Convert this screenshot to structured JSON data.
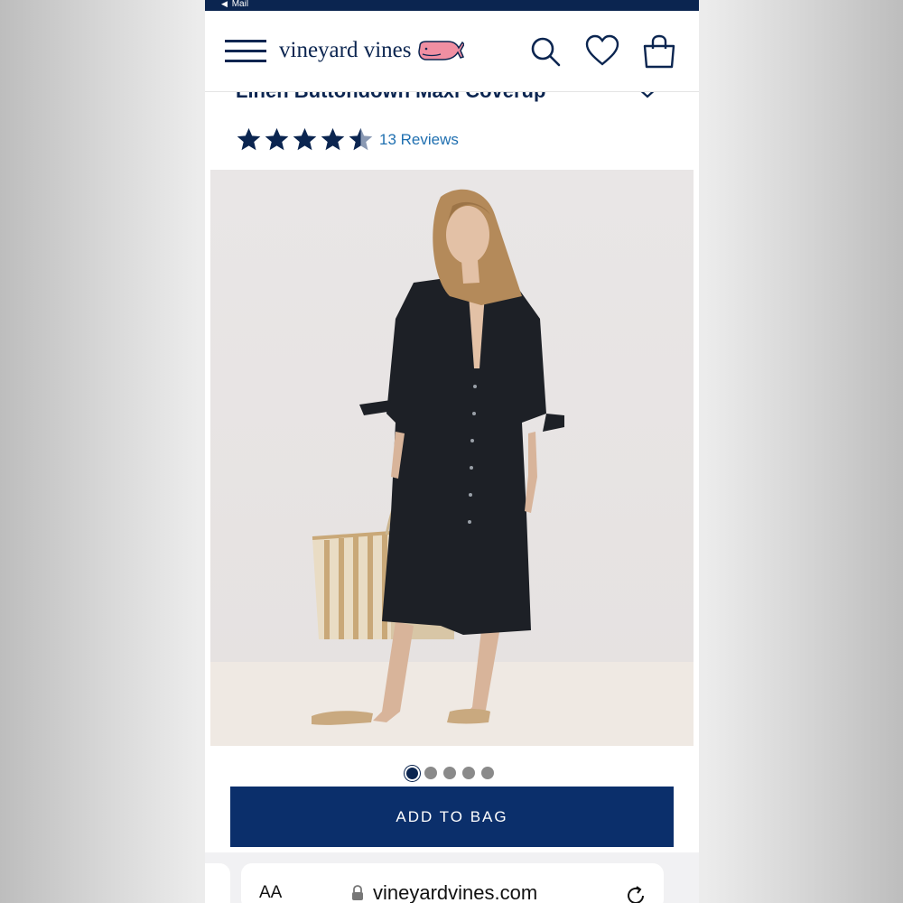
{
  "status_bar": {
    "back_arrow": "◀",
    "back_label": "Mail"
  },
  "header": {
    "brand": "vineyard vines",
    "icons": [
      "hamburger-menu-icon",
      "whale-logo-icon",
      "search-icon",
      "heart-icon",
      "shopping-bag-icon"
    ]
  },
  "product": {
    "title_partial": "Linen Buttondown Maxi Coverup",
    "rating_stars": 4.5,
    "rating_max": 5,
    "reviews_label": "13 Reviews",
    "image_count": 5,
    "active_image": 1
  },
  "cta": {
    "add_to_bag": "ADD TO BAG"
  },
  "browser": {
    "text_size_label": "AA",
    "url": "vineyardvines.com"
  },
  "colors": {
    "navy": "#0b2550",
    "button": "#0b2f6b",
    "link": "#1f6fb0",
    "star": "#0b2550"
  }
}
